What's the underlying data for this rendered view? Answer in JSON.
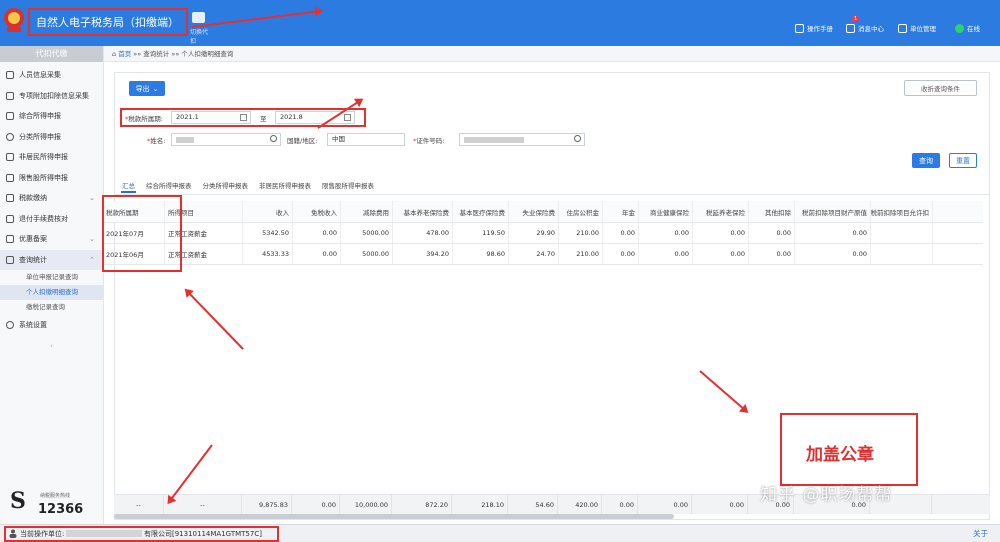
{
  "header": {
    "title": "自然人电子税务局（扣缴端）",
    "org_switch_label": "切换代扣",
    "buttons": [
      {
        "label": "操作手册",
        "icon": "manual-icon"
      },
      {
        "label": "消息中心",
        "icon": "message-icon",
        "badge": "1"
      },
      {
        "label": "单位管理",
        "icon": "unit-icon"
      },
      {
        "label": "在线",
        "icon": "online-icon"
      }
    ]
  },
  "sidebar": {
    "heading": "代扣代缴",
    "items": [
      {
        "label": "人员信息采集",
        "icon": "person-icon"
      },
      {
        "label": "专项附加扣除信息采集",
        "icon": "list-icon"
      },
      {
        "label": "综合所得申报",
        "icon": "report-icon"
      },
      {
        "label": "分类所得申报",
        "icon": "pie-icon"
      },
      {
        "label": "非居民所得申报",
        "icon": "person-outline-icon"
      },
      {
        "label": "限售股所得申报",
        "icon": "stock-icon"
      },
      {
        "label": "税款缴纳",
        "icon": "coin-icon"
      },
      {
        "label": "退付手续费核对",
        "icon": "refund-icon"
      },
      {
        "label": "优惠备案",
        "icon": "gift-icon"
      },
      {
        "label": "查询统计",
        "icon": "chart-icon"
      }
    ],
    "sub_items": [
      "单位申报记录查询",
      "个人扣缴明细查询",
      "缴税记录查询"
    ],
    "settings_label": "系统设置",
    "hotline_caption": "纳税服务热线",
    "hotline_number": "12366"
  },
  "breadcrumb": {
    "home": "首页",
    "path": "»» 查询统计 »» 个人扣缴明细查询"
  },
  "toolbar": {
    "export_label": "导出",
    "collapse_label": "收折查询条件"
  },
  "filters": {
    "period_label": "税款所属期:",
    "period_from": "2021.1",
    "period_sep": "至",
    "period_to": "2021.8",
    "name_label": "姓名:",
    "country_label": "国籍/地区:",
    "country_value": "中国",
    "id_label": "证件号码:",
    "query_label": "查询",
    "reset_label": "重置"
  },
  "tabs": [
    "汇总",
    "综合所得申报表",
    "分类所得申报表",
    "非居民所得申报表",
    "限售股所得申报表"
  ],
  "table": {
    "columns": [
      "税款所属期",
      "所得项目",
      "收入",
      "免税收入",
      "减除费用",
      "基本养老保险费",
      "基本医疗保险费",
      "失业保险费",
      "住房公积金",
      "年金",
      "商业健康保险",
      "税延养老保险",
      "其他扣除",
      "税前扣除项目财产原值",
      "税前扣除项目允许扣"
    ],
    "rows": [
      [
        "2021年07月",
        "正常工资薪金",
        "5342.50",
        "0.00",
        "5000.00",
        "478.00",
        "119.50",
        "29.90",
        "210.00",
        "0.00",
        "0.00",
        "0.00",
        "0.00",
        "0.00",
        ""
      ],
      [
        "2021年06月",
        "正常工资薪金",
        "4533.33",
        "0.00",
        "5000.00",
        "394.20",
        "98.60",
        "24.70",
        "210.00",
        "0.00",
        "0.00",
        "0.00",
        "0.00",
        "0.00",
        ""
      ]
    ],
    "totals": [
      "--",
      "--",
      "9,875.83",
      "0.00",
      "10,000.00",
      "872.20",
      "218.10",
      "54.60",
      "420.00",
      "0.00",
      "0.00",
      "0.00",
      "0.00",
      "0.00",
      ""
    ]
  },
  "status": {
    "label": "当前操作单位:",
    "org": "有限公司[91310114MA1GTMT57C]",
    "about": "关于"
  },
  "annotation": {
    "stamp": "加盖公章",
    "watermark": "知乎 @职场帮帮"
  }
}
